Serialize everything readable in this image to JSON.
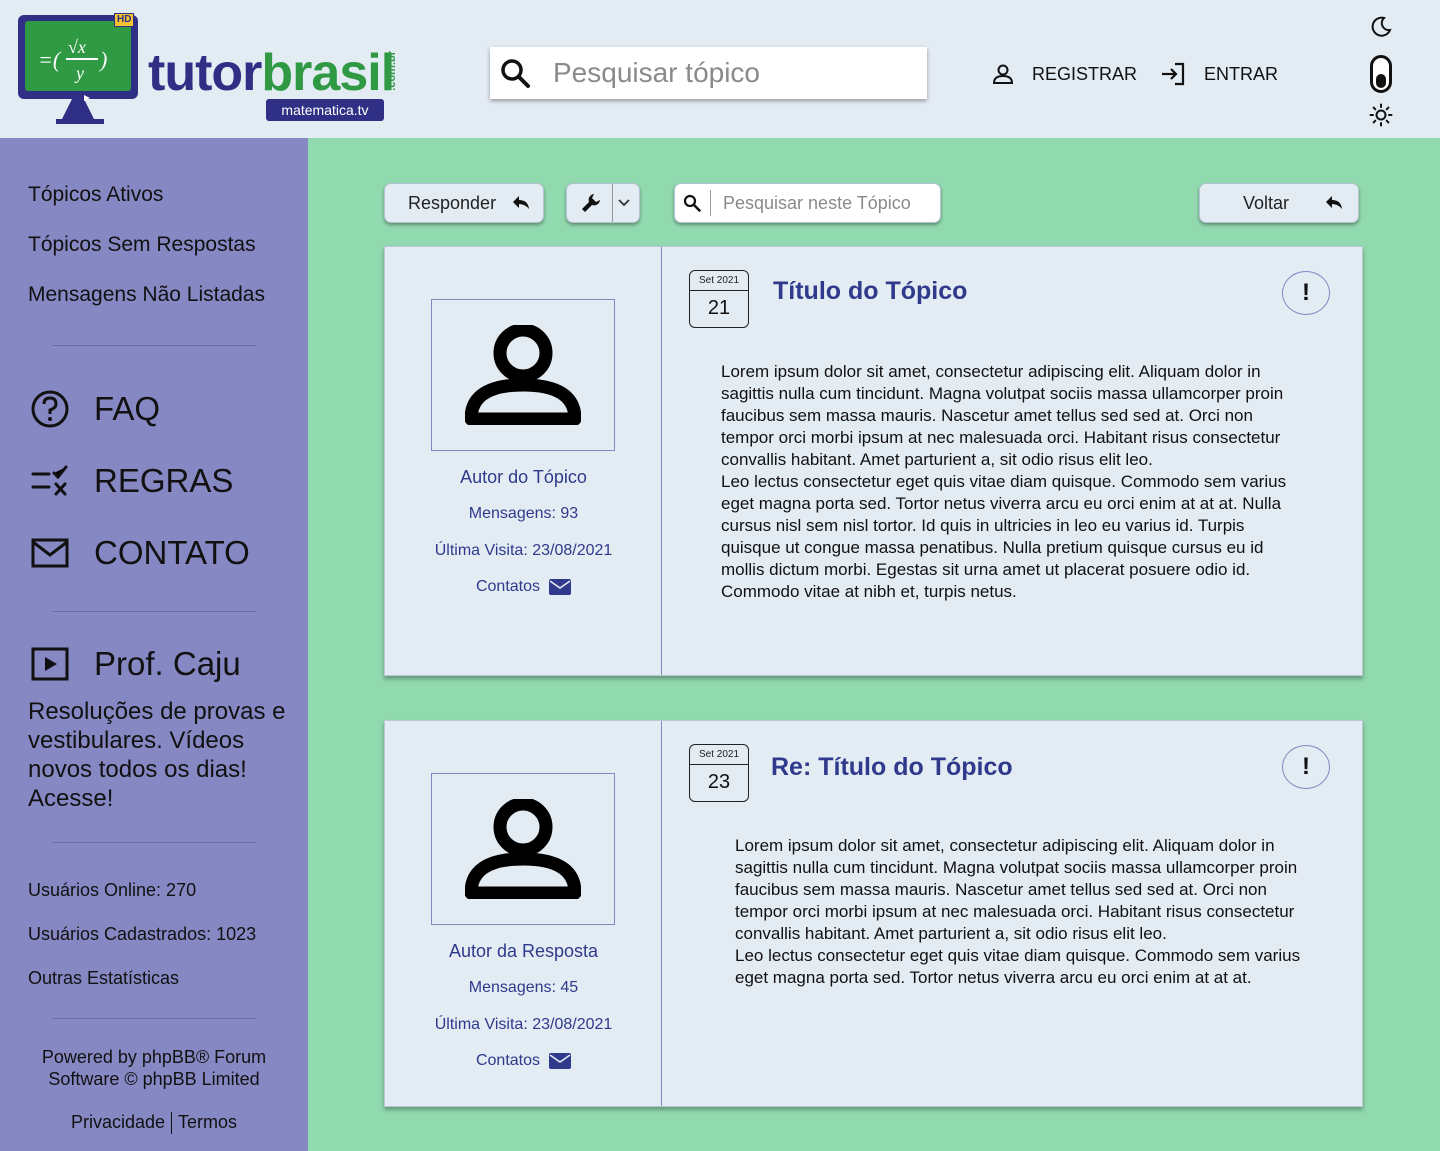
{
  "header": {
    "logo": {
      "word1": "tutor",
      "word2": "brasil",
      "com": ".com.br",
      "badge": "matematica.tv",
      "hd": "HD"
    },
    "search_placeholder": "Pesquisar tópico",
    "register_label": "REGISTRAR",
    "login_label": "ENTRAR"
  },
  "sidebar": {
    "links": [
      "Tópicos Ativos",
      "Tópicos Sem Respostas",
      "Mensagens Não Listadas"
    ],
    "faq": "FAQ",
    "rules": "REGRAS",
    "contact": "CONTATO",
    "prof": "Prof. Caju",
    "promo": "Resoluções de provas e vestibulares. Vídeos novos todos os dias! Acesse!",
    "stats": [
      "Usuários Online: 270",
      "Usuários Cadastrados: 1023",
      "Outras Estatísticas"
    ],
    "powered": "Powered by phpBB® Forum Software © phpBB Limited",
    "privacy": "Privacidade",
    "terms": "Termos"
  },
  "toolbar": {
    "reply_label": "Responder",
    "search_placeholder": "Pesquisar neste Tópico",
    "back_label": "Voltar"
  },
  "posts": [
    {
      "author": "Autor do Tópico",
      "messages": "Mensagens: 93",
      "last_visit": "Última Visita: 23/08/2021",
      "contacts": "Contatos",
      "month": "Set 2021",
      "day": "21",
      "title": "Título do Tópico",
      "report": "!",
      "paragraphs": [
        "Lorem ipsum dolor sit amet, consectetur adipiscing elit. Aliquam dolor in sagittis nulla cum tincidunt. Magna volutpat sociis massa ullamcorper proin faucibus sem massa mauris. Nascetur amet tellus sed sed at. Orci non tempor orci morbi ipsum at nec malesuada orci. Habitant risus consectetur convallis habitant. Amet parturient a, sit odio risus elit leo.",
        "Leo lectus consectetur eget quis vitae diam quisque. Commodo sem varius eget magna porta sed. Tortor netus viverra arcu eu orci enim at at at. Nulla cursus nisl sem nisl tortor. Id quis in ultricies in leo eu varius id. Turpis quisque ut congue massa penatibus. Nulla pretium quisque cursus eu id mollis dictum morbi. Egestas sit urna amet ut placerat posuere odio id. Commodo vitae at nibh et, turpis netus."
      ]
    },
    {
      "author": "Autor da Resposta",
      "messages": "Mensagens: 45",
      "last_visit": "Última Visita: 23/08/2021",
      "contacts": "Contatos",
      "month": "Set 2021",
      "day": "23",
      "title": "Re: Título do Tópico",
      "report": "!",
      "paragraphs": [
        "Lorem ipsum dolor sit amet, consectetur adipiscing elit. Aliquam dolor in sagittis nulla cum tincidunt. Magna volutpat sociis massa ullamcorper proin faucibus sem massa mauris. Nascetur amet tellus sed sed at. Orci non tempor orci morbi ipsum at nec malesuada orci. Habitant risus consectetur convallis habitant. Amet parturient a, sit odio risus elit leo.",
        "Leo lectus consectetur eget quis vitae diam quisque. Commodo sem varius eget magna porta sed. Tortor netus viverra arcu eu orci enim at at at."
      ]
    }
  ],
  "colors": {
    "header_bg": "#e3ebf3",
    "sidebar_bg": "#8688c3",
    "content_bg": "#91d9ae",
    "post_bg": "#e3ebf3",
    "accent": "#2f3a8c",
    "brand_green": "#2f9a43"
  },
  "icons": [
    "search-icon",
    "user-icon",
    "login-icon",
    "moon-icon",
    "sun-icon",
    "help-icon",
    "rules-icon",
    "mail-icon",
    "play-icon",
    "reply-icon",
    "wrench-icon",
    "chevron-down-icon",
    "avatar-icon",
    "envelope-icon"
  ]
}
